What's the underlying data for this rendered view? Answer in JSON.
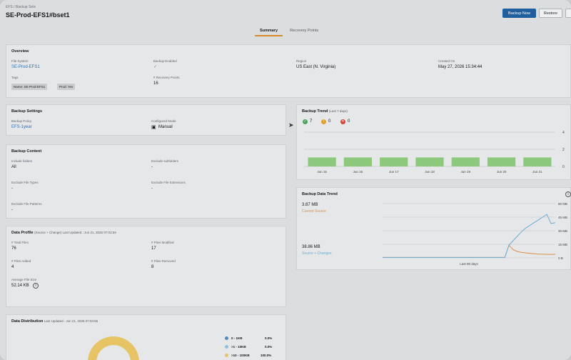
{
  "header": {
    "breadcrumb": "EFS / Backup Sets",
    "title": "SE-Prod-EFS1#bset1",
    "backup_now_label": "Backup Now",
    "restore_label": "Restore"
  },
  "tabs": [
    {
      "label": "Summary",
      "active": true
    },
    {
      "label": "Recovery Points",
      "active": false
    }
  ],
  "overview": {
    "title": "Overview",
    "file_system_label": "File System",
    "file_system_value": "SE-Prod-EFS1",
    "backup_enabled_label": "Backup Enabled",
    "region_label": "Region",
    "region_value": "US East (N. Virginia)",
    "created_on_label": "Created On",
    "created_on_value": "May 27, 2026 15:34:44",
    "tags_label": "Tags",
    "tags": [
      "Name: SE-Prod-EFS1",
      "Prod: Yes"
    ],
    "recovery_points_label": "# Recovery Points",
    "recovery_points_value": "16"
  },
  "backup_settings": {
    "title": "Backup Settings",
    "policy_label": "Backup Policy",
    "policy_value": "EFS-1year",
    "mode_label": "Configured Mode",
    "mode_value": "Manual"
  },
  "backup_content": {
    "title": "Backup Content",
    "include_folders_label": "Include folders",
    "include_folders_value": "All",
    "exclude_subfolders_label": "Exclude subfolders",
    "exclude_subfolders_value": "-",
    "exclude_file_types_label": "Exclude File Types",
    "exclude_file_types_value": "-",
    "exclude_file_ext_label": "Exclude File Extensions",
    "exclude_file_ext_value": "-",
    "exclude_file_patterns_label": "Exclude File Patterns",
    "exclude_file_patterns_value": "-"
  },
  "data_profile": {
    "title": "Data Profile",
    "subtitle": "(Source + Change) Last Updated : Jun 21, 2026 07:03:55",
    "total_files_label": "# Total Files",
    "total_files_value": "76",
    "files_modified_label": "# Files Modified",
    "files_modified_value": "17",
    "files_added_label": "# Files Added",
    "files_added_value": "4",
    "files_removed_label": "# Files Removed",
    "files_removed_value": "8",
    "avg_size_label": "Average File Size",
    "avg_size_value": "52.14 KB"
  },
  "data_distribution": {
    "title": "Data Distribution",
    "subtitle": "Last Updated : Jun 21, 2026 07:03:55",
    "buckets": [
      {
        "label": "0 - 1KB",
        "pct": "0.0%",
        "color": "#4a8cc4"
      },
      {
        "label": ">1 - 10KB",
        "pct": "0.0%",
        "color": "#8fc0d8"
      },
      {
        "label": ">10 - 100KB",
        "pct": "100.0%",
        "color": "#e6c466"
      }
    ]
  },
  "chart_data": [
    {
      "type": "bar",
      "title": "Backup Trend",
      "subtitle": "(Last 7 days)",
      "status_counts": {
        "success": "7",
        "warning": "0",
        "failed": "0"
      },
      "categories": [
        "Jun 15",
        "Jun 16",
        "Jun 17",
        "Jun 18",
        "Jun 19",
        "Jun 20",
        "Jun 21"
      ],
      "values": [
        1,
        1,
        1,
        1,
        1,
        1,
        1
      ],
      "yticks": [
        "4",
        "2",
        "0"
      ],
      "ylim": [
        0,
        4
      ],
      "colors": {
        "bar": "#8cc97c",
        "success": "#46a35a",
        "warning": "#e0a030",
        "failed": "#d0443a"
      }
    },
    {
      "type": "line",
      "title": "Backup Data Trend",
      "xlabel": "Last 90 days",
      "yticks": [
        "60 MB",
        "45 MB",
        "30 MB",
        "15 MB",
        "0 B"
      ],
      "ylim": [
        0,
        60
      ],
      "current_source_value": "3.87 MB",
      "current_source_label": "Current Source",
      "source_changes_value": "38.86 MB",
      "source_changes_label": "Source + Changes",
      "series": [
        {
          "name": "Current Source",
          "color": "#d9904a",
          "values": [
            0.5,
            0.5,
            0.5,
            0.5,
            0.5,
            0.5,
            0.5,
            0.5,
            0.5,
            0.5,
            0.5,
            0.5,
            0.5,
            0.5,
            0.5,
            0.5,
            0.5,
            0.5,
            0.5,
            0.5,
            0.5,
            0.5,
            0.5,
            0.5,
            0.5,
            0.5,
            0.5,
            0.5,
            0.5,
            0.5,
            14,
            9,
            7,
            6,
            5.5,
            5,
            4.5,
            4.2,
            4,
            3.9,
            3.9,
            3.87
          ]
        },
        {
          "name": "Source + Changes",
          "color": "#6aaed6",
          "values": [
            0.5,
            0.5,
            0.5,
            0.5,
            0.5,
            0.5,
            0.5,
            0.5,
            0.5,
            0.5,
            0.5,
            0.5,
            0.5,
            0.5,
            0.5,
            0.5,
            0.5,
            0.5,
            0.5,
            0.5,
            0.5,
            0.5,
            0.5,
            0.5,
            0.5,
            0.5,
            0.5,
            0.5,
            0.5,
            0.5,
            14,
            19,
            24,
            29,
            33,
            36,
            39,
            42,
            45,
            48,
            38,
            38.86
          ]
        }
      ]
    }
  ]
}
